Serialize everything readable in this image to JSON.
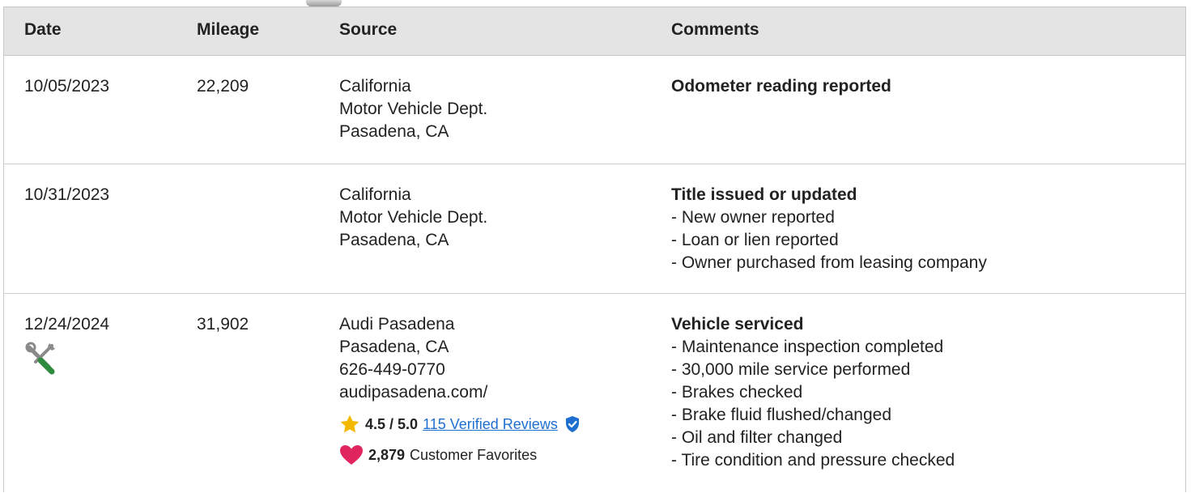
{
  "colors": {
    "header_bg": "#e4e4e4",
    "link": "#1f6fd1",
    "star": "#f5b800",
    "heart": "#e0245e",
    "verified": "#1f6fd1",
    "wrench_green": "#2e8b3e"
  },
  "table": {
    "headers": {
      "date": "Date",
      "mileage": "Mileage",
      "source": "Source",
      "comments": "Comments"
    },
    "rows": [
      {
        "date": "10/05/2023",
        "mileage": "22,209",
        "source": [
          "California",
          "Motor Vehicle Dept.",
          "Pasadena, CA"
        ],
        "comment_title": "Odometer reading reported",
        "comment_items": []
      },
      {
        "date": "10/31/2023",
        "mileage": "",
        "source": [
          "California",
          "Motor Vehicle Dept.",
          "Pasadena, CA"
        ],
        "comment_title": "Title issued or updated",
        "comment_items": [
          "- New owner reported",
          "- Loan or lien reported",
          "- Owner purchased from leasing company"
        ]
      },
      {
        "date": "12/24/2024",
        "date_icon": "service-tools-icon",
        "mileage": "31,902",
        "source": [
          "Audi Pasadena",
          "Pasadena, CA",
          "626-449-0770",
          "audipasadena.com/"
        ],
        "rating": {
          "icon": "star-icon",
          "value": "4.5 / 5.0",
          "reviews_link": "115 Verified Reviews",
          "badge_icon": "verified-badge-icon"
        },
        "favorites": {
          "icon": "heart-icon",
          "count": "2,879",
          "label": "Customer Favorites"
        },
        "comment_title": "Vehicle serviced",
        "comment_items": [
          "- Maintenance inspection completed",
          "- 30,000 mile service performed",
          "- Brakes checked",
          "- Brake fluid flushed/changed",
          "- Oil and filter changed",
          "- Tire condition and pressure checked"
        ]
      }
    ]
  }
}
